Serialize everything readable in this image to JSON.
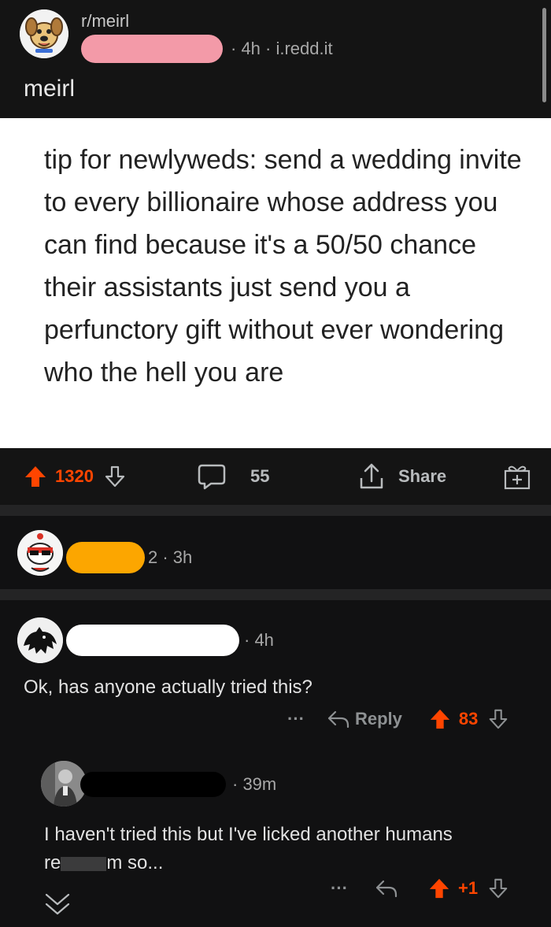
{
  "post": {
    "subreddit": "r/meirl",
    "meta": "· 4h · i.redd.it",
    "title": "meirl",
    "image_text": "tip for newlyweds: send a wedding invite to every billionaire whose address you can find because it's a 50/50 chance their assistants just send you a perfunctory gift without ever wondering who the hell you are"
  },
  "actions": {
    "upvotes": "1320",
    "comments": "55",
    "share_label": "Share"
  },
  "comments": [
    {
      "meta": "2 · 3h"
    },
    {
      "meta": "· 4h",
      "body": "Ok, has anyone actually tried this?",
      "more": "···",
      "reply_label": "Reply",
      "score": "83"
    },
    {
      "meta": "· 39m",
      "body_line1": "I haven't tried this but I've licked another humans",
      "body_line2_start": "re",
      "body_line2_end": "m so...",
      "more": "···",
      "score": "+1"
    }
  ],
  "colors": {
    "upvote": "#ff4500",
    "background": "#111112",
    "redaction_pink": "#f39aa8",
    "redaction_orange": "#fca600"
  },
  "icons": [
    "dog-avatar-icon",
    "upvote-icon",
    "downvote-icon",
    "comment-icon",
    "share-icon",
    "award-icon",
    "reply-icon",
    "collapse-chevron-icon"
  ]
}
